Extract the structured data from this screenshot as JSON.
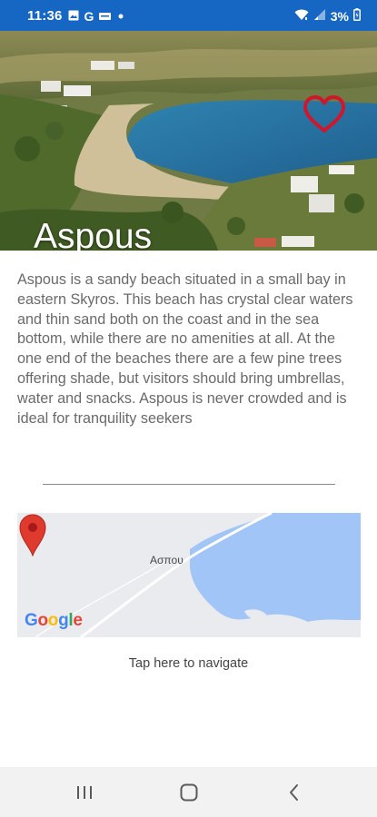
{
  "status_bar": {
    "time": "11:36",
    "left_icons": [
      "gallery-icon",
      "google-g-icon",
      "message-icon",
      "dot-icon"
    ],
    "google_letter": "G",
    "right_icons": [
      "wifi-icon",
      "signal-icon",
      "battery-icon"
    ],
    "battery_percent": "3%"
  },
  "hero": {
    "title": "Aspous",
    "favorite_icon": "heart-outline-icon",
    "favorite_color": "#d0162a"
  },
  "description": "Aspous is a sandy beach situated in a small bay in eastern Skyros. This beach has crystal clear waters and thin sand both on the coast and in the sea bottom, while there are no amenities at all. At the one end of the beaches there are a few pine trees offering shade, but visitors should bring umbrellas, water and snacks. Aspous is never crowded and is ideal for tranquility seekers",
  "map": {
    "place_label": "Ασπου",
    "logo_text": "Google",
    "pin_color": "#e03a2f",
    "water_color": "#a1c5f6"
  },
  "navigate_label": "Tap here to navigate",
  "nav_bar": {
    "buttons": [
      "recents-icon",
      "home-icon",
      "back-icon"
    ]
  },
  "colors": {
    "status_bar": "#1667c3",
    "text": "#6a6a6a"
  }
}
